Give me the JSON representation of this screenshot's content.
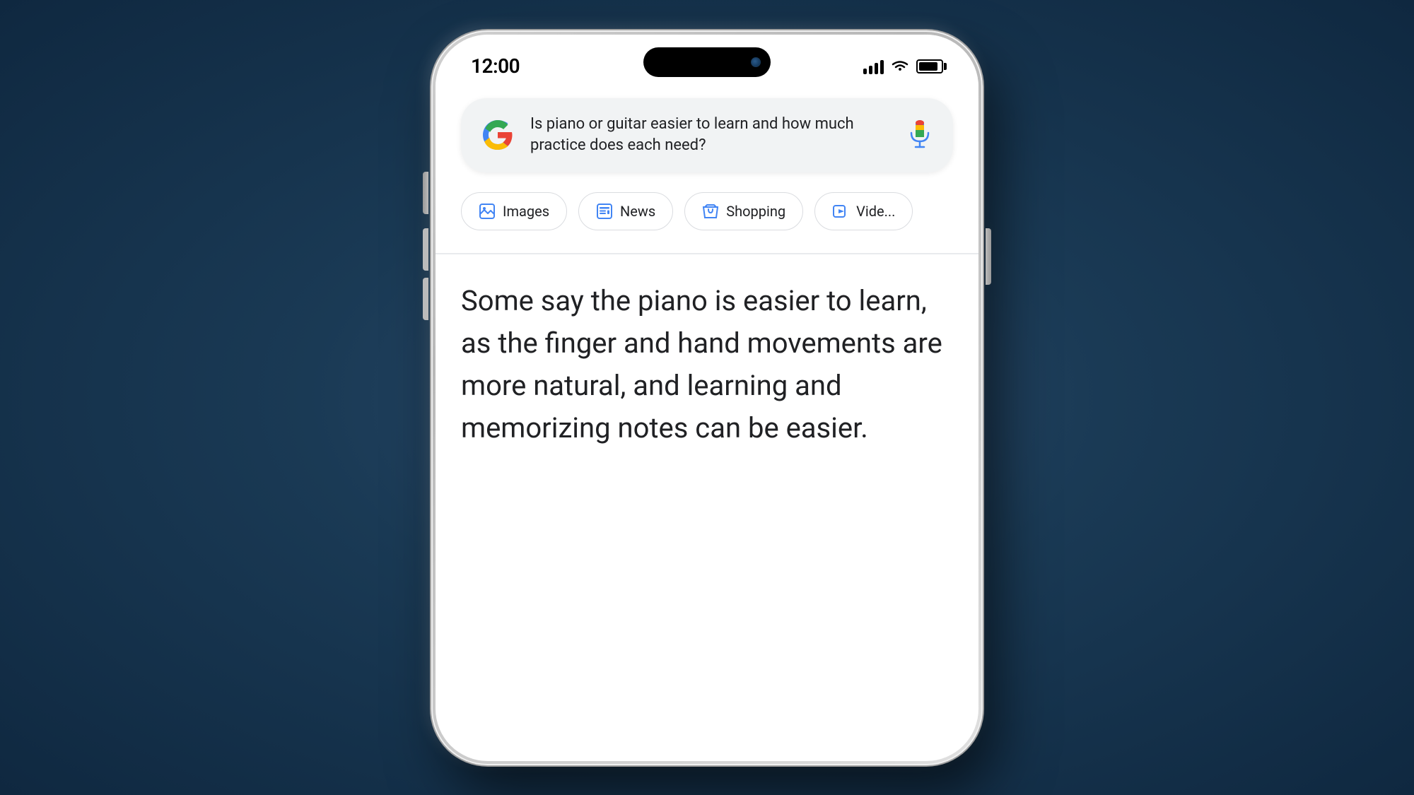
{
  "phone": {
    "status_bar": {
      "time": "12:00"
    },
    "search_bar": {
      "query": "Is piano or guitar easier to learn and how much practice does each need?"
    },
    "filter_chips": [
      {
        "id": "images",
        "label": "Images",
        "icon": "images-icon"
      },
      {
        "id": "news",
        "label": "News",
        "icon": "news-icon"
      },
      {
        "id": "shopping",
        "label": "Shopping",
        "icon": "shopping-icon"
      },
      {
        "id": "videos",
        "label": "Vide...",
        "icon": "video-icon"
      }
    ],
    "result_text": "Some say the piano is easier to learn, as the finger and hand movements are more natural, and learning and memorizing notes can be easier."
  }
}
